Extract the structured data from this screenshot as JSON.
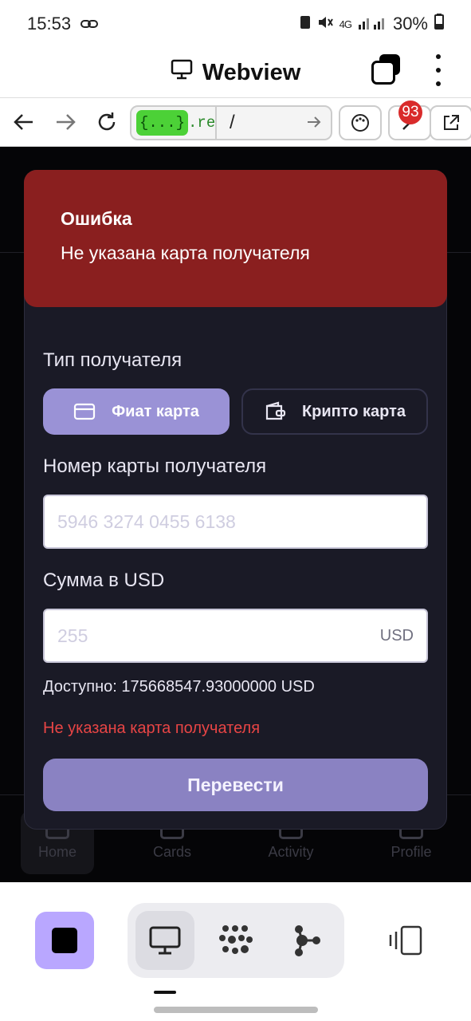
{
  "status_bar": {
    "time": "15:53",
    "battery": "30%",
    "network": "4G"
  },
  "app_bar": {
    "title": "Webview"
  },
  "url_bar": {
    "chip": "{...}",
    "host": ".rep",
    "path": "/",
    "notification_count": "93"
  },
  "toast": {
    "title": "Ошибка",
    "message": "Не указана карта получателя"
  },
  "form": {
    "recipient_type_label": "Тип получателя",
    "fiat_option": "Фиат карта",
    "crypto_option": "Крипто карта",
    "card_label": "Номер карты получателя",
    "card_placeholder": "5946 3274 0455 6138",
    "amount_label": "Сумма в USD",
    "amount_placeholder": "255",
    "amount_suffix": "USD",
    "available": "Доступно: 175668547.93000000 USD",
    "error": "Не указана карта получателя",
    "submit": "Перевести"
  },
  "bottom_nav": {
    "items": [
      "Home",
      "Cards",
      "Activity",
      "Profile"
    ]
  },
  "colors": {
    "toast_bg": "#8a1f1f",
    "accent": "#9a92d6",
    "error_text": "#e84545",
    "modal_bg": "#1a1a26"
  }
}
